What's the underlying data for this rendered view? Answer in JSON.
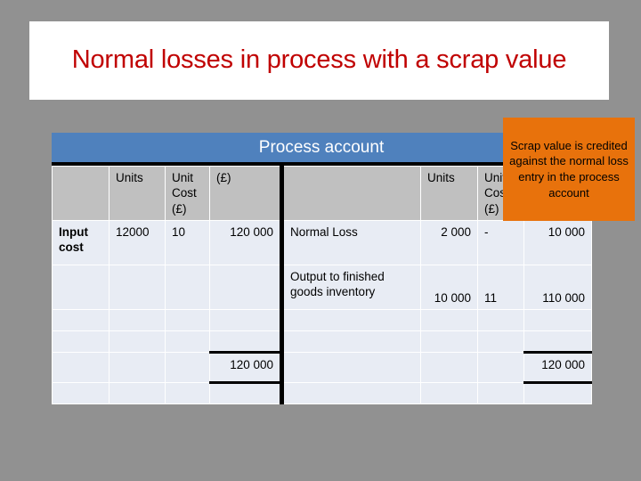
{
  "slide": {
    "background_color": "#919191",
    "title": "Normal losses in process with a scrap value",
    "title_color": "#c00000"
  },
  "table": {
    "caption": "Process account",
    "caption_bar_color": "#4f81bd",
    "header_row_color": "#c0c0c0",
    "body_row_color": "#e8ecf4",
    "debit_headers": {
      "label": "",
      "units": "Units",
      "unit_cost": "Unit Cost (£)",
      "amount": "(£)"
    },
    "credit_headers": {
      "label": "",
      "units": "Units",
      "unit_cost": "Unit Cost (£)",
      "amount": ""
    },
    "debit_rows": [
      {
        "label": "Input cost",
        "units": "12000",
        "unit_cost": "10",
        "amount": "120 000"
      },
      {
        "label": "",
        "units": "",
        "unit_cost": "",
        "amount": ""
      },
      {
        "label": "",
        "units": "",
        "unit_cost": "",
        "amount": ""
      },
      {
        "label": "",
        "units": "",
        "unit_cost": "",
        "amount": ""
      }
    ],
    "credit_rows": [
      {
        "label": "Normal Loss",
        "units": "2 000",
        "unit_cost": "-",
        "amount": "10 000"
      },
      {
        "label": "Output to finished goods inventory",
        "units": "10 000",
        "unit_cost": "11",
        "amount": "110 000"
      },
      {
        "label": "",
        "units": "",
        "unit_cost": "",
        "amount": ""
      },
      {
        "label": "",
        "units": "",
        "unit_cost": "",
        "amount": ""
      }
    ],
    "totals": {
      "debit_total": "120 000",
      "credit_total": "120 000"
    }
  },
  "callout": {
    "text": "Scrap value is credited against the normal loss entry in the process account",
    "background_color": "#e8720c",
    "text_color": "#000000"
  }
}
